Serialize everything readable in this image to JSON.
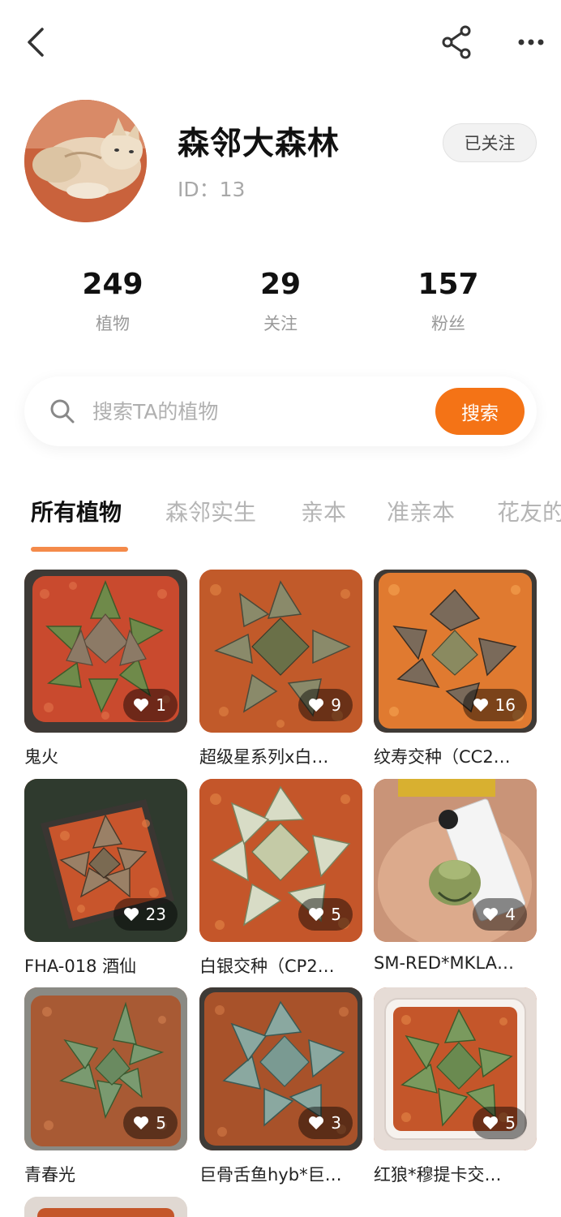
{
  "topbar": {
    "back_icon": "chevron-left-icon",
    "share_icon": "share-icon",
    "more_icon": "more-horizontal-icon"
  },
  "profile": {
    "name": "森邻大森林",
    "id_text": "ID：13",
    "follow_label": "已关注"
  },
  "stats": [
    {
      "value": "249",
      "label": "植物"
    },
    {
      "value": "29",
      "label": "关注"
    },
    {
      "value": "157",
      "label": "粉丝"
    }
  ],
  "search": {
    "placeholder": "搜索TA的植物",
    "button_label": "搜索"
  },
  "tabs": [
    "所有植物",
    "森邻实生",
    "亲本",
    "准亲本",
    "花友的"
  ],
  "plants": [
    {
      "name": "鬼火",
      "likes": "1"
    },
    {
      "name": "超级星系列x白…",
      "likes": "9"
    },
    {
      "name": "纹寿交种（CC2…",
      "likes": "16"
    },
    {
      "name": "FHA-018 酒仙",
      "likes": "23"
    },
    {
      "name": "白银交种（CP2…",
      "likes": "5"
    },
    {
      "name": "SM-RED*MKLA…",
      "likes": "4"
    },
    {
      "name": "青春光",
      "likes": "5"
    },
    {
      "name": "巨骨舌鱼hyb*巨…",
      "likes": "3"
    },
    {
      "name": "红狼*穆提卡交…",
      "likes": "5"
    }
  ],
  "colors": {
    "accent": "#f47316",
    "tab_underline": "#f48a4a"
  }
}
